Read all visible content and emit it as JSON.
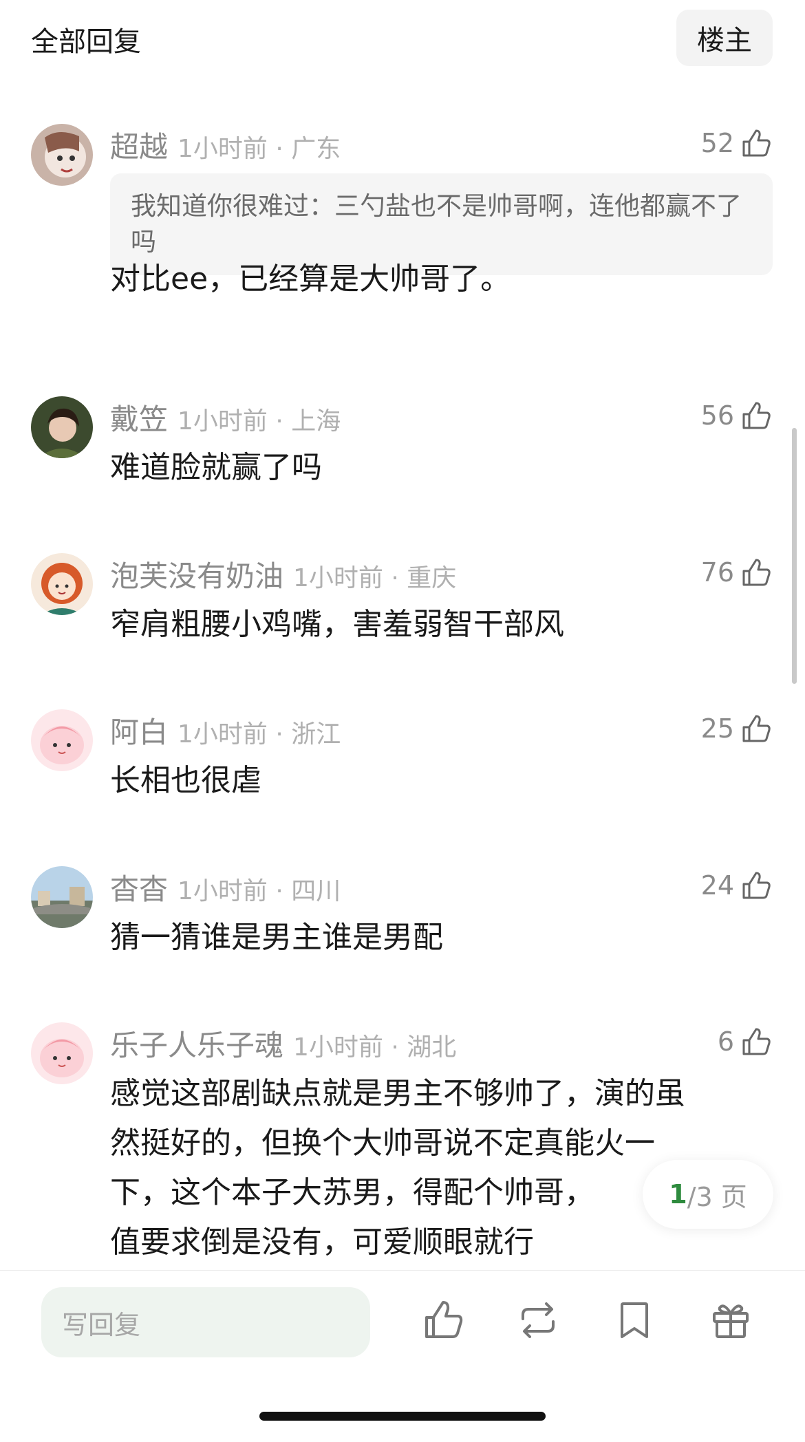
{
  "header": {
    "title": "全部回复",
    "owner_button": "楼主"
  },
  "comments": [
    {
      "username": "超越",
      "time_location": "1小时前 · 广东",
      "likes": "52",
      "quote": "我知道你很难过：三勺盐也不是帅哥啊，连他都赢不了吗",
      "text": "对比ee，已经算是大帅哥了。"
    },
    {
      "username": "戴笠",
      "time_location": "1小时前 · 上海",
      "likes": "56",
      "text": "难道脸就赢了吗"
    },
    {
      "username": "泡芙没有奶油",
      "time_location": "1小时前 · 重庆",
      "likes": "76",
      "text": "窄肩粗腰小鸡嘴，害羞弱智干部风"
    },
    {
      "username": "阿白",
      "time_location": "1小时前 · 浙江",
      "likes": "25",
      "text": "长相也很虐"
    },
    {
      "username": "杳杳",
      "time_location": "1小时前 · 四川",
      "likes": "24",
      "text": "猜一猜谁是男主谁是男配"
    },
    {
      "username": "乐子人乐子魂",
      "time_location": "1小时前 · 湖北",
      "likes": "6",
      "text_lines": [
        "感觉这部剧缺点就是男主不够帅了，演的虽",
        "然挺好的，但换个大帅哥说不定真能火一",
        "下，这个本子大苏男，得配个帅哥，",
        "值要求倒是没有，可爱顺眼就行"
      ]
    }
  ],
  "pager": {
    "current": "1",
    "total_text": "/3 页"
  },
  "bottom_bar": {
    "reply_placeholder": "写回复",
    "icons": [
      "like-icon",
      "repost-icon",
      "bookmark-icon",
      "gift-icon"
    ]
  },
  "colors": {
    "accent": "#2e8b3e",
    "muted_text": "#8a8a8a",
    "input_bg": "#eef4ef"
  }
}
